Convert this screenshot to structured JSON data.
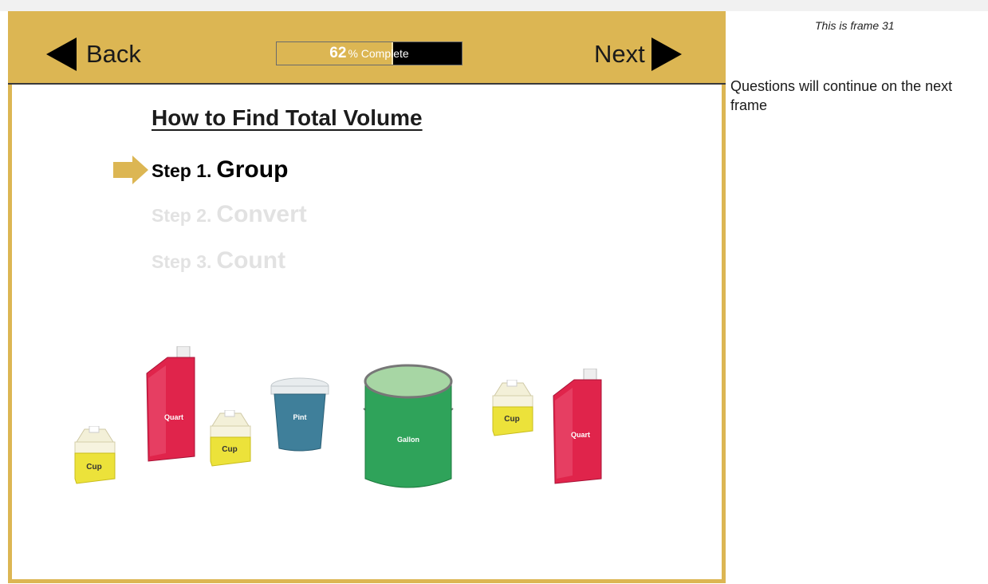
{
  "header": {
    "back_label": "Back",
    "next_label": "Next",
    "progress": {
      "percent": 62,
      "percent_text": "62",
      "suffix_text": "% Complete"
    }
  },
  "lesson": {
    "title": "How to Find Total Volume",
    "steps": [
      {
        "prefix": "Step 1.",
        "name": "Group",
        "active": true
      },
      {
        "prefix": "Step 2.",
        "name": "Convert",
        "active": false
      },
      {
        "prefix": "Step 3.",
        "name": "Count",
        "active": false
      }
    ]
  },
  "illustration": {
    "containers": [
      "Cup",
      "Quart",
      "Cup",
      "Pint",
      "Gallon",
      "Cup",
      "Quart"
    ]
  },
  "sidebar": {
    "frame_text": "This is frame 31",
    "note": "Questions will continue on the next frame"
  },
  "colors": {
    "accent_gold": "#dcb653",
    "quart_red": "#e0244b",
    "cup_yellow": "#ece23a",
    "pint_blue": "#3f7f9a",
    "gallon_green": "#2fa35a"
  }
}
